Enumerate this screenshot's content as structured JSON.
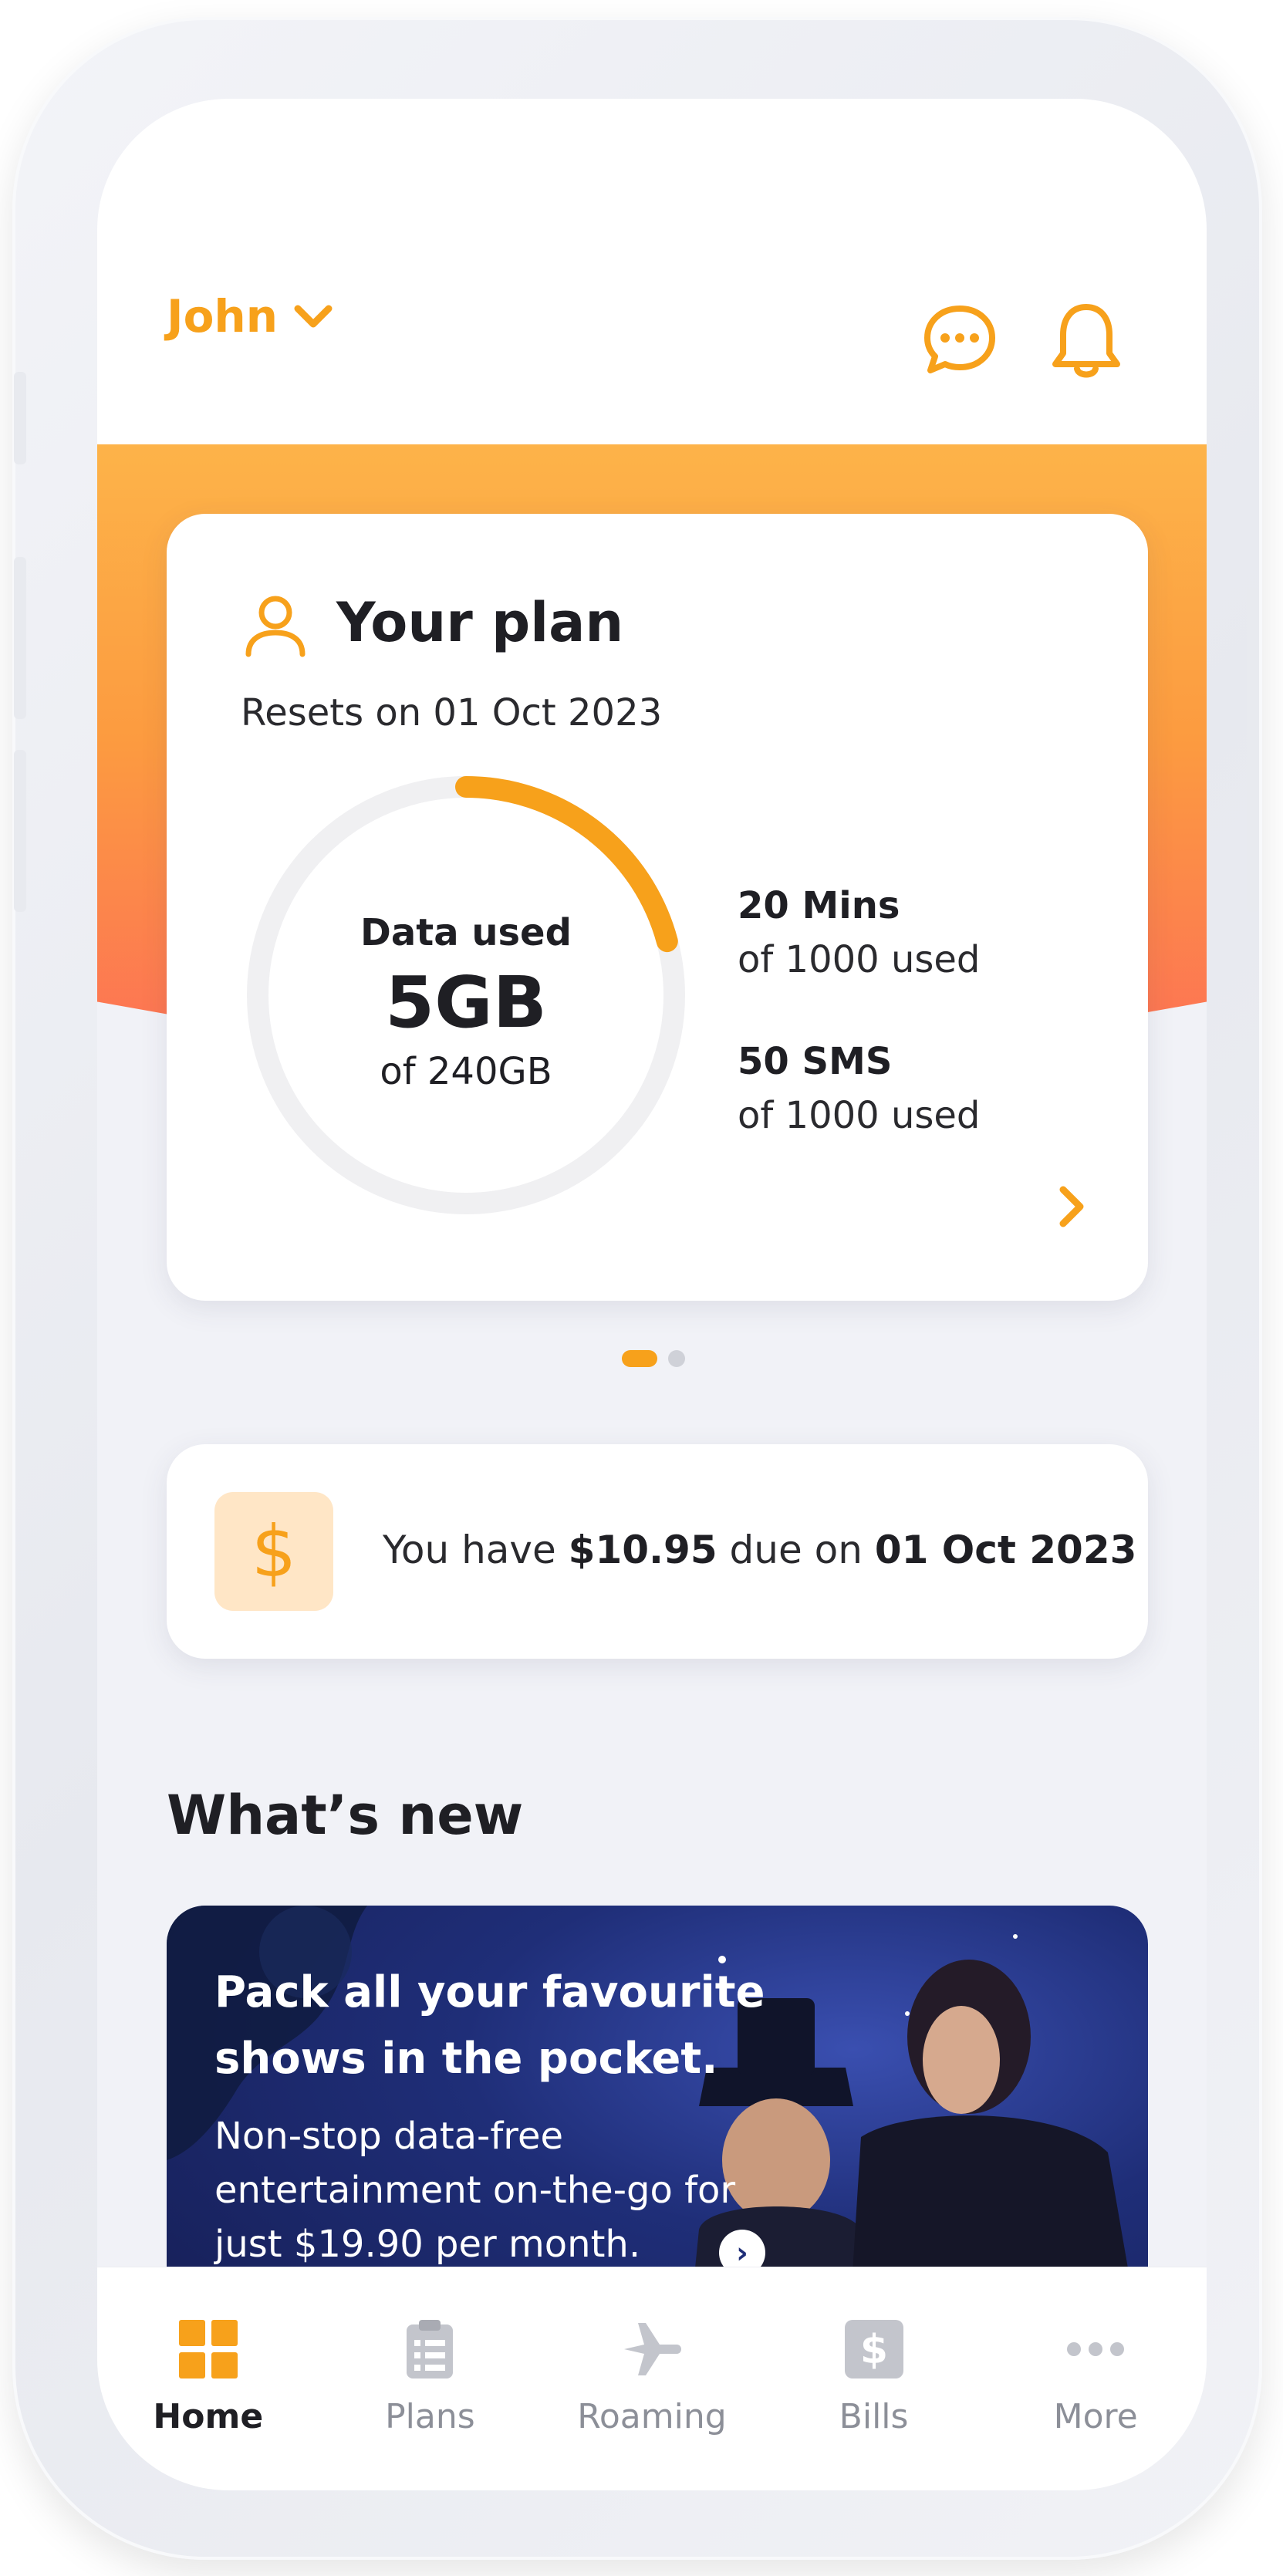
{
  "header": {
    "user_name": "John"
  },
  "plan": {
    "title": "Your plan",
    "reset_text": "Resets on 01 Oct 2023",
    "data_label": "Data used",
    "data_used": "5GB",
    "data_total": "of 240GB",
    "data_used_fraction": 0.2083,
    "mins_title": "20 Mins",
    "mins_sub": "of 1000 used",
    "sms_title": "50 SMS",
    "sms_sub": "of 1000 used"
  },
  "bill": {
    "prefix": "You have",
    "amount": "$10.95",
    "middle": "due on",
    "due_date": "01 Oct 2023",
    "icon_glyph": "$"
  },
  "whats_new": {
    "heading": "What’s new",
    "promo_title": "Pack all your favourite shows in the pocket.",
    "promo_body": "Non-stop data-free entertainment on-the-go for just $19.90 per month."
  },
  "tabs": [
    {
      "label": "Home",
      "icon": "home-icon",
      "active": true
    },
    {
      "label": "Plans",
      "icon": "clipboard-icon",
      "active": false
    },
    {
      "label": "Roaming",
      "icon": "plane-icon",
      "active": false
    },
    {
      "label": "Bills",
      "icon": "dollar-icon",
      "active": false
    },
    {
      "label": "More",
      "icon": "more-dots-icon",
      "active": false
    }
  ],
  "colors": {
    "accent": "#f7a11b",
    "hero_top": "#fdb349",
    "hero_bottom": "#fd6c58",
    "inactive": "#b8bac1"
  }
}
